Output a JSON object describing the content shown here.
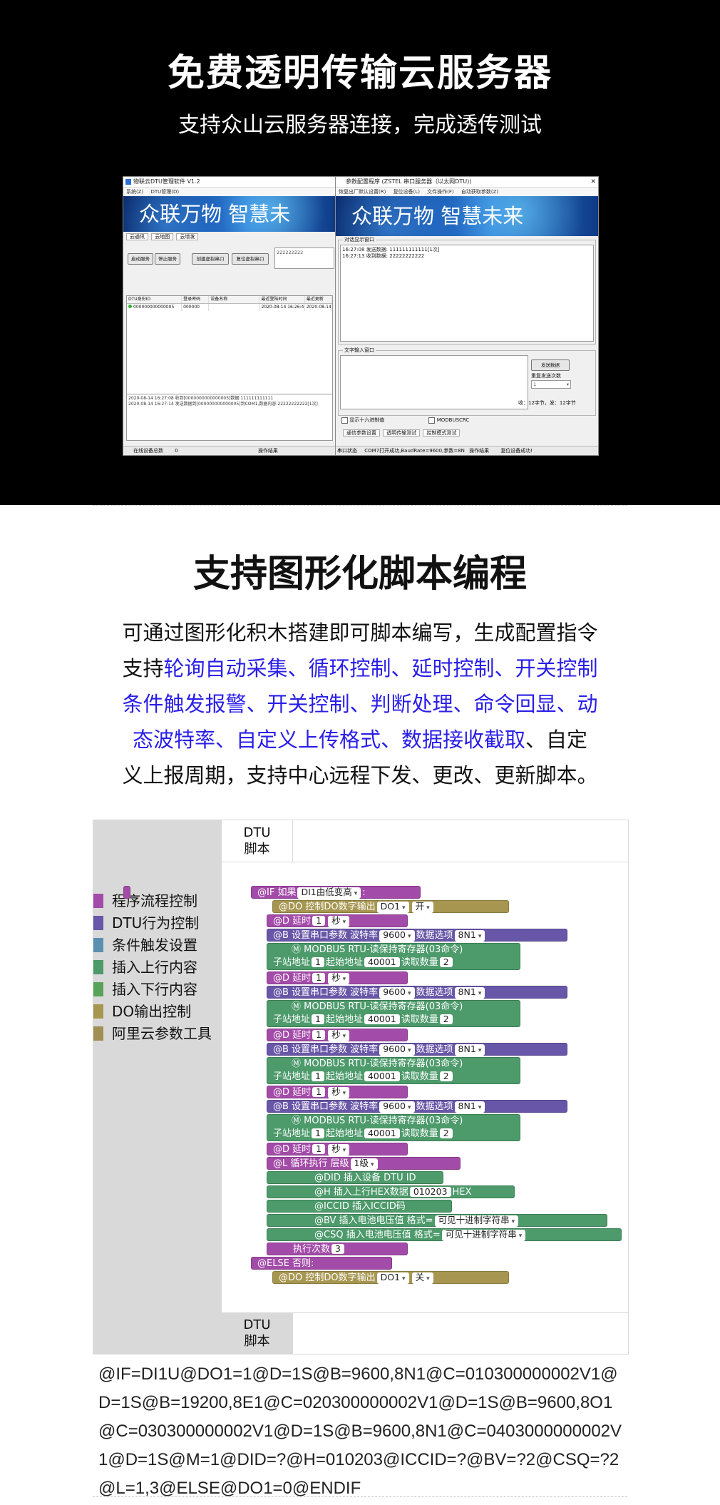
{
  "section1": {
    "title": "免费透明传输云服务器",
    "subtitle": "支持众山云服务器连接，完成透传测试"
  },
  "win_left": {
    "title": "物联云DTU管理软件 V1.2",
    "menu": [
      "系统(Z)",
      "DTU管理(D)"
    ],
    "banner": "众联万物   智慧未",
    "tabs": [
      "云通讯",
      "云地图",
      "云增发"
    ],
    "btn_start": "启动服务",
    "btn_stop": "停止服务",
    "btn_create": "创建虚拟串口",
    "btn_reset": "复位虚拟串口",
    "input_placeholder": "222222222",
    "grid_headers": [
      "DTU身份ID",
      "登录密码",
      "设备名称",
      "最近登陆时间",
      "最近更新"
    ],
    "grid_row": [
      "000000000000005",
      "000000",
      "",
      "2020-08-14 16:26:43",
      "2020-08-14 16:"
    ],
    "log_lines": [
      "2020-08-14 16:27:08 收到[0000000000000005]数据:111111111111",
      "2020-08-14 16:27:14 发送数据到[000000000000005]到COM1,数据内容:22222222222[1次]"
    ],
    "status_left": "在线设备总数",
    "status_count": "0",
    "status_right": "操作结果"
  },
  "win_right": {
    "title": "参数配置程序 (ZSTEL 串口服务器（以太网DTU))",
    "menu": [
      "恢复出厂默认设置(R)",
      "复位设备(L)",
      "文件操作(F)",
      "自动获取参数(Z)"
    ],
    "banner": "众联万物   智慧未来",
    "box_display": "对话显示窗口",
    "display_lines": [
      "16:27:08 发送数据: 111111111111[1次]",
      "16:27:13 收到数据: 22222222222"
    ],
    "box_input": "文字输入窗口",
    "btn_send": "发送数据",
    "repeat_label": "重复发送次数",
    "repeat_value": "1",
    "counts": "收：12字节，发：12字节",
    "check_hex": "显示十六进制值",
    "check_modbus": "MODBUSCRC",
    "bottom_tabs": [
      "通信参数设置",
      "透明传输测试",
      "控制模式测试"
    ],
    "status": [
      "串口状态",
      "COM7打开成功,BaudRate=9600,参数=8N",
      "操作结果",
      "复位设备成功!"
    ]
  },
  "section2": {
    "title": "支持图形化脚本编程",
    "line1": "可通过图形化积木搭建即可脚本编写，生成配置指令",
    "line2_a": "支持",
    "line2_b": "轮询自动采集、循环控制、延时控制、开关控制",
    "line3": "条件触发报警、开关控制、判断处理、命令回显、动",
    "line4_a": "态波特率、自定义上传格式、数据接收截取",
    "line4_b": "、自定",
    "line5": "义上报周期，支持中心远程下发、更改、更新脚本。"
  },
  "colors": {
    "highlight_blue": "#2a1ee8",
    "flow": "#a34ba8",
    "dtu_behavior": "#6856a8",
    "condition": "#5b8fb0",
    "upload": "#4d9a6b",
    "download": "#58a35a",
    "do_output": "#a79650",
    "aliyun": "#a08e55"
  },
  "panel": {
    "head_top": "DTU\n脚本",
    "head_bottom": "DTU\n脚本",
    "legend": [
      {
        "label": "程序流程控制",
        "color": "#a34ba8"
      },
      {
        "label": "DTU行为控制",
        "color": "#6856a8"
      },
      {
        "label": "条件触发设置",
        "color": "#5b8fb0"
      },
      {
        "label": "插入上行内容",
        "color": "#4d9a6b"
      },
      {
        "label": "插入下行内容",
        "color": "#58a35a"
      },
      {
        "label": "DO输出控制",
        "color": "#a79650"
      },
      {
        "label": "阿里云参数工具",
        "color": "#a08e55"
      }
    ],
    "blocks": {
      "if_a": "@IF   如果",
      "if_f": "DI1由低变高",
      "if_b": ":",
      "do1_a": "@DO   控制DO数字输出",
      "do1_f1": "DO1",
      "do1_f2": "开",
      "d_a": "@D   延时",
      "d_f1": "1",
      "d_f2": "秒",
      "b_a": "@B   设置串口参数  波特率",
      "b_f1": "9600",
      "b_b": "数据选项",
      "b_f2": "8N1",
      "m_line1": "Ⓜ      MODBUS    RTU-读保持寄存器(03命令)",
      "m_a": "子站地址",
      "m_f1": "1",
      "m_b": "起始地址",
      "m_f2": "40001",
      "m_c": "读取数量",
      "m_f3": "2",
      "l_a": "@L   循环执行     层级",
      "l_f": "1级",
      "did": "@DID   插入设备 DTU ID",
      "h_a": "@H   插入上行HEX数据",
      "h_f": "010203",
      "h_b": "HEX",
      "iccid": "@ICCID    插入ICCID码",
      "bv_a": "@BV    插入电池电压值        格式=",
      "bv_f": "可见十进制字符串",
      "csq_a": "@CSQ    插入电池电压值        格式=",
      "csq_f": "可见十进制字符串",
      "times_a": "执行次数",
      "times_f": "3",
      "else": "@ELSE      否则:",
      "do2_a": "@DO   控制DO数字输出",
      "do2_f1": "DO1",
      "do2_f2": "关"
    }
  },
  "script_code": "@IF=DI1U@DO1=1@D=1S@B=9600,8N1@C=010300000002V1@D=1S@B=19200,8E1@C=020300000002V1@D=1S@B=9600,8O1@C=030300000002V1@D=1S@B=9600,8N1@C=0403000000002V1@D=1S@M=1@DID=?@H=010203@ICCID=?@BV=?2@CSQ=?2@L=1,3@ELSE@DO1=0@ENDIF"
}
